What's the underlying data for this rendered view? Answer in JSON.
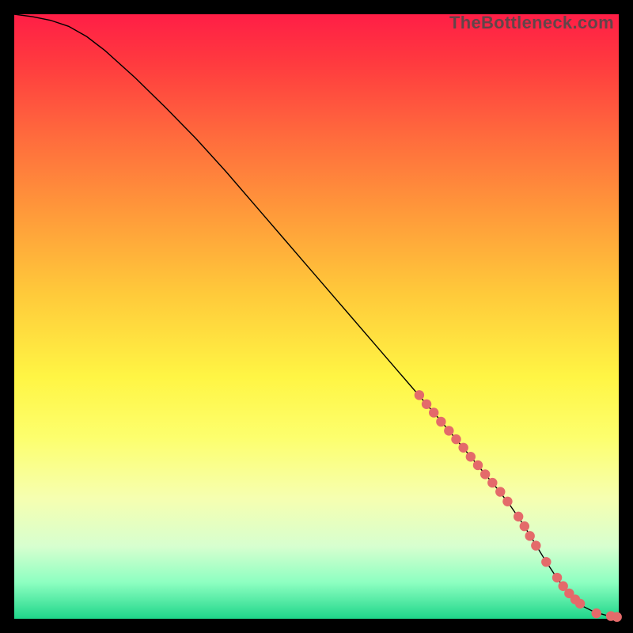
{
  "watermark": "TheBottleneck.com",
  "chart_data": {
    "type": "line",
    "title": "",
    "xlabel": "",
    "ylabel": "",
    "xlim": [
      0,
      100
    ],
    "ylim": [
      0,
      100
    ],
    "grid": false,
    "series": [
      {
        "name": "curve",
        "x": [
          0,
          3,
          6,
          9,
          12,
          15,
          20,
          25,
          30,
          35,
          40,
          45,
          50,
          55,
          60,
          65,
          70,
          72,
          74,
          76,
          78,
          80,
          82,
          84,
          86,
          88,
          90,
          92,
          94,
          96,
          98,
          100
        ],
        "values": [
          100,
          99.6,
          99.0,
          98.0,
          96.3,
          94.0,
          89.5,
          84.6,
          79.5,
          74.0,
          68.2,
          62.4,
          56.6,
          50.8,
          45.0,
          39.2,
          33.4,
          31.0,
          28.6,
          26.2,
          23.8,
          21.4,
          18.8,
          15.9,
          12.7,
          9.4,
          6.4,
          3.9,
          2.1,
          1.1,
          0.55,
          0.25
        ]
      }
    ],
    "markers": {
      "name": "highlighted-points",
      "x": [
        67.0,
        68.2,
        69.4,
        70.6,
        71.9,
        73.1,
        74.3,
        75.5,
        76.7,
        77.9,
        79.1,
        80.4,
        81.6,
        83.4,
        84.4,
        85.3,
        86.3,
        88.0,
        89.8,
        90.8,
        91.8,
        92.8,
        93.6,
        96.3,
        98.7,
        99.7
      ],
      "values": [
        37.0,
        35.5,
        34.1,
        32.6,
        31.1,
        29.7,
        28.3,
        26.8,
        25.4,
        23.9,
        22.5,
        21.0,
        19.4,
        16.9,
        15.3,
        13.7,
        12.1,
        9.4,
        6.8,
        5.4,
        4.2,
        3.2,
        2.5,
        0.9,
        0.45,
        0.3
      ]
    }
  }
}
